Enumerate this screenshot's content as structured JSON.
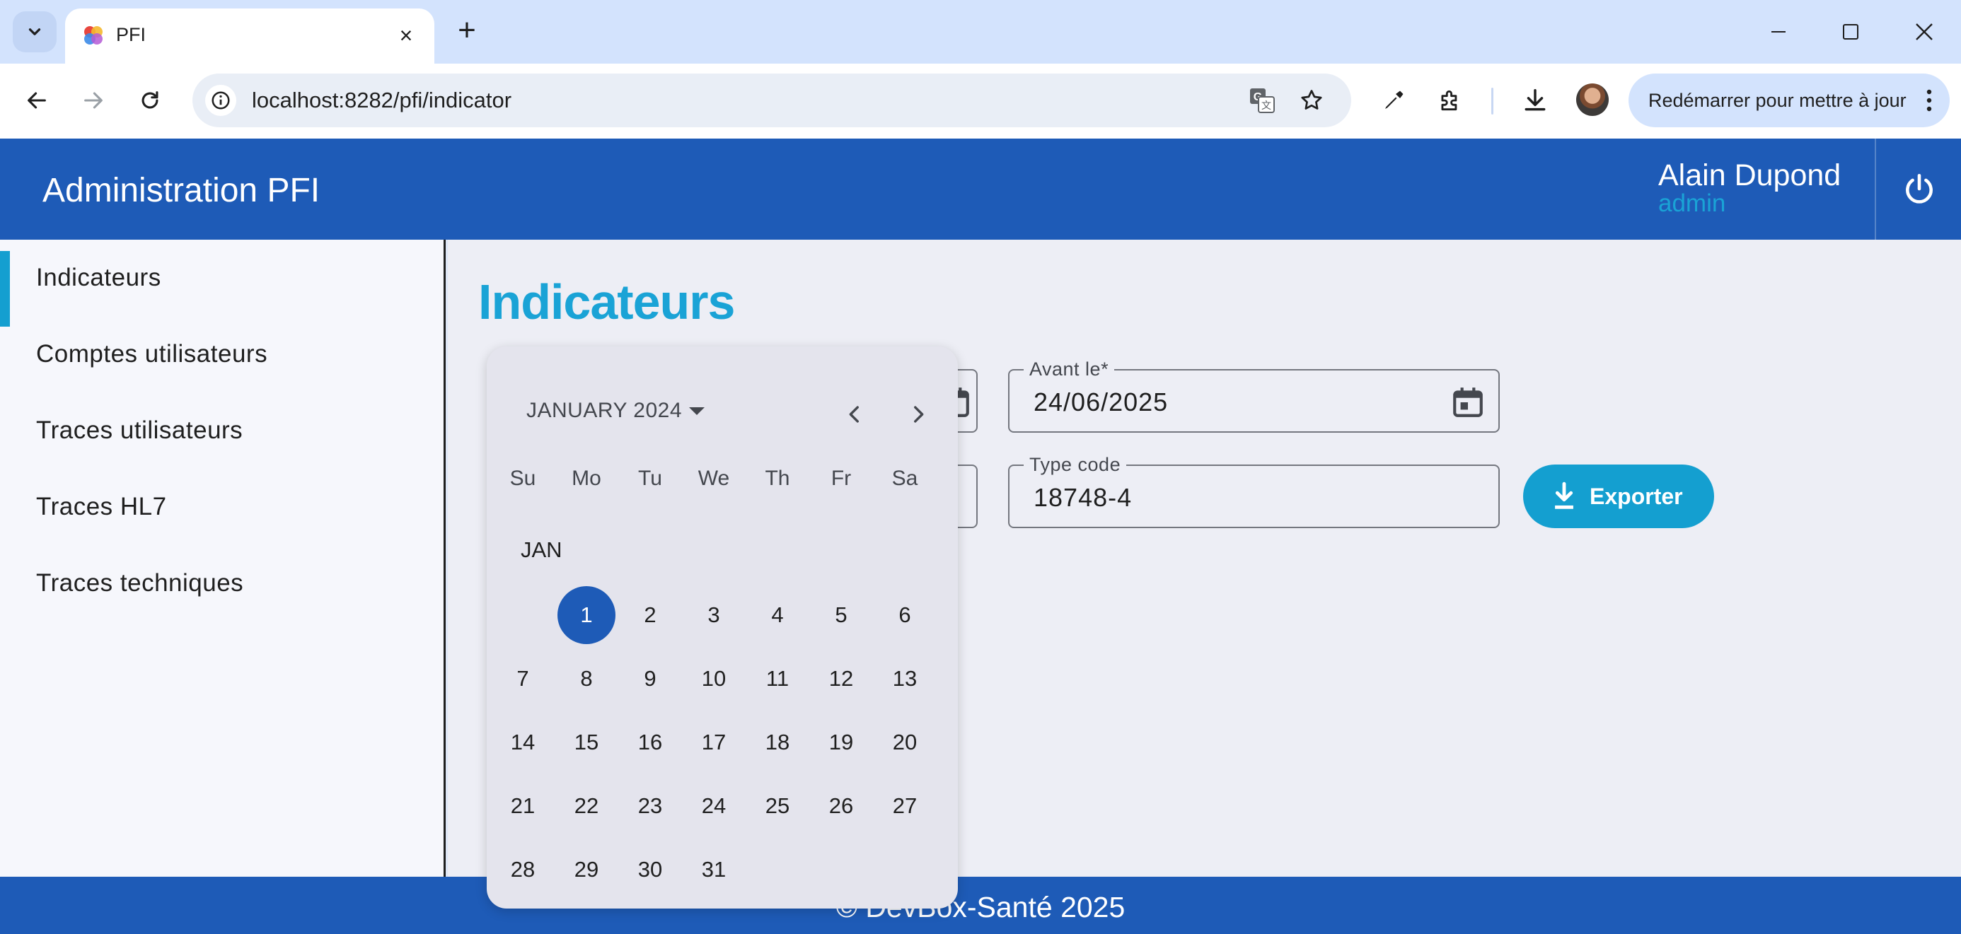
{
  "browser": {
    "tab_title": "PFI",
    "new_tab_symbol": "+",
    "close_tab_symbol": "×",
    "url": "localhost:8282/pfi/indicator",
    "restart_label": "Redémarrer pour mettre à jour"
  },
  "app": {
    "title": "Administration PFI",
    "user_name": "Alain Dupond",
    "user_role": "admin",
    "page_title": "Indicateurs",
    "footer": "© DevBox-Santé 2025"
  },
  "sidebar": {
    "items": [
      {
        "label": "Indicateurs",
        "active": true
      },
      {
        "label": "Comptes utilisateurs",
        "active": false
      },
      {
        "label": "Traces utilisateurs",
        "active": false
      },
      {
        "label": "Traces HL7",
        "active": false
      },
      {
        "label": "Traces techniques",
        "active": false
      }
    ]
  },
  "form": {
    "before_label": "Avant le*",
    "before_value": "24/06/2025",
    "type_code_label": "Type code",
    "type_code_value": "18748-4",
    "export_label": "Exporter"
  },
  "datepicker": {
    "period_label": "JANUARY 2024",
    "weekdays": [
      "Su",
      "Mo",
      "Tu",
      "We",
      "Th",
      "Fr",
      "Sa"
    ],
    "month_label": "JAN",
    "first_weekday_offset": 1,
    "days": [
      "1",
      "2",
      "3",
      "4",
      "5",
      "6",
      "7",
      "8",
      "9",
      "10",
      "11",
      "12",
      "13",
      "14",
      "15",
      "16",
      "17",
      "18",
      "19",
      "20",
      "21",
      "22",
      "23",
      "24",
      "25",
      "26",
      "27",
      "28",
      "29",
      "30",
      "31"
    ],
    "selected_day": "1"
  },
  "colors": {
    "brand_blue": "#1e5bb7",
    "accent_cyan": "#149fd0"
  }
}
